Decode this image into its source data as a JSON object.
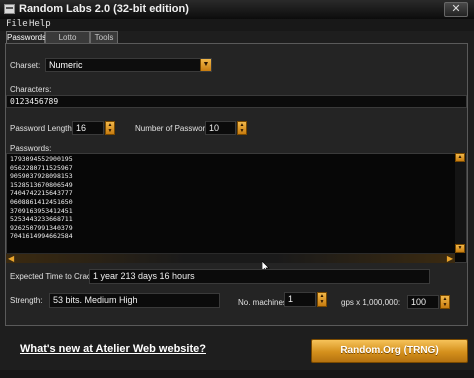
{
  "window": {
    "title": "Random Labs 2.0 (32-bit edition)",
    "close_glyph": "✕",
    "app_icon": "keyboard-icon"
  },
  "menu": [
    {
      "label": "File"
    },
    {
      "label": "Help"
    }
  ],
  "tabs": [
    {
      "label": "Passwords",
      "active": true
    },
    {
      "label": "Lotto Games",
      "active": false
    },
    {
      "label": "Tools",
      "active": false
    }
  ],
  "charset": {
    "label": "Charset:",
    "value": "Numeric"
  },
  "characters": {
    "label": "Characters:",
    "value": "0123456789"
  },
  "password_length": {
    "label": "Password Length:",
    "value": "16"
  },
  "number_of_passwords": {
    "label": "Number of Passwords:",
    "value": "10"
  },
  "passwords": {
    "label": "Passwords:",
    "items": [
      "1793094552900195",
      "0562280711525967",
      "9059037928098153",
      "1528513670806549",
      "7404742215643777",
      "0608861412451650",
      "3709163953412451",
      "5253443233668711",
      "9262507991340379",
      "7041614994662584"
    ]
  },
  "time_to_crack": {
    "label": "Expected Time to Crack:",
    "value": "1 year 213 days 16 hours"
  },
  "strength": {
    "label": "Strength:",
    "value": "53 bits. Medium High"
  },
  "machines": {
    "label": "No. machines:",
    "value": "1"
  },
  "gps": {
    "label": "gps x 1,000,000:",
    "value": "100"
  },
  "footer": {
    "link_label": "What's new at Atelier Web website?",
    "button_label": "Random.Org (TRNG)"
  },
  "colors": {
    "accent": "#e8a42c",
    "background": "#242424",
    "field": "#0b0b0b"
  }
}
